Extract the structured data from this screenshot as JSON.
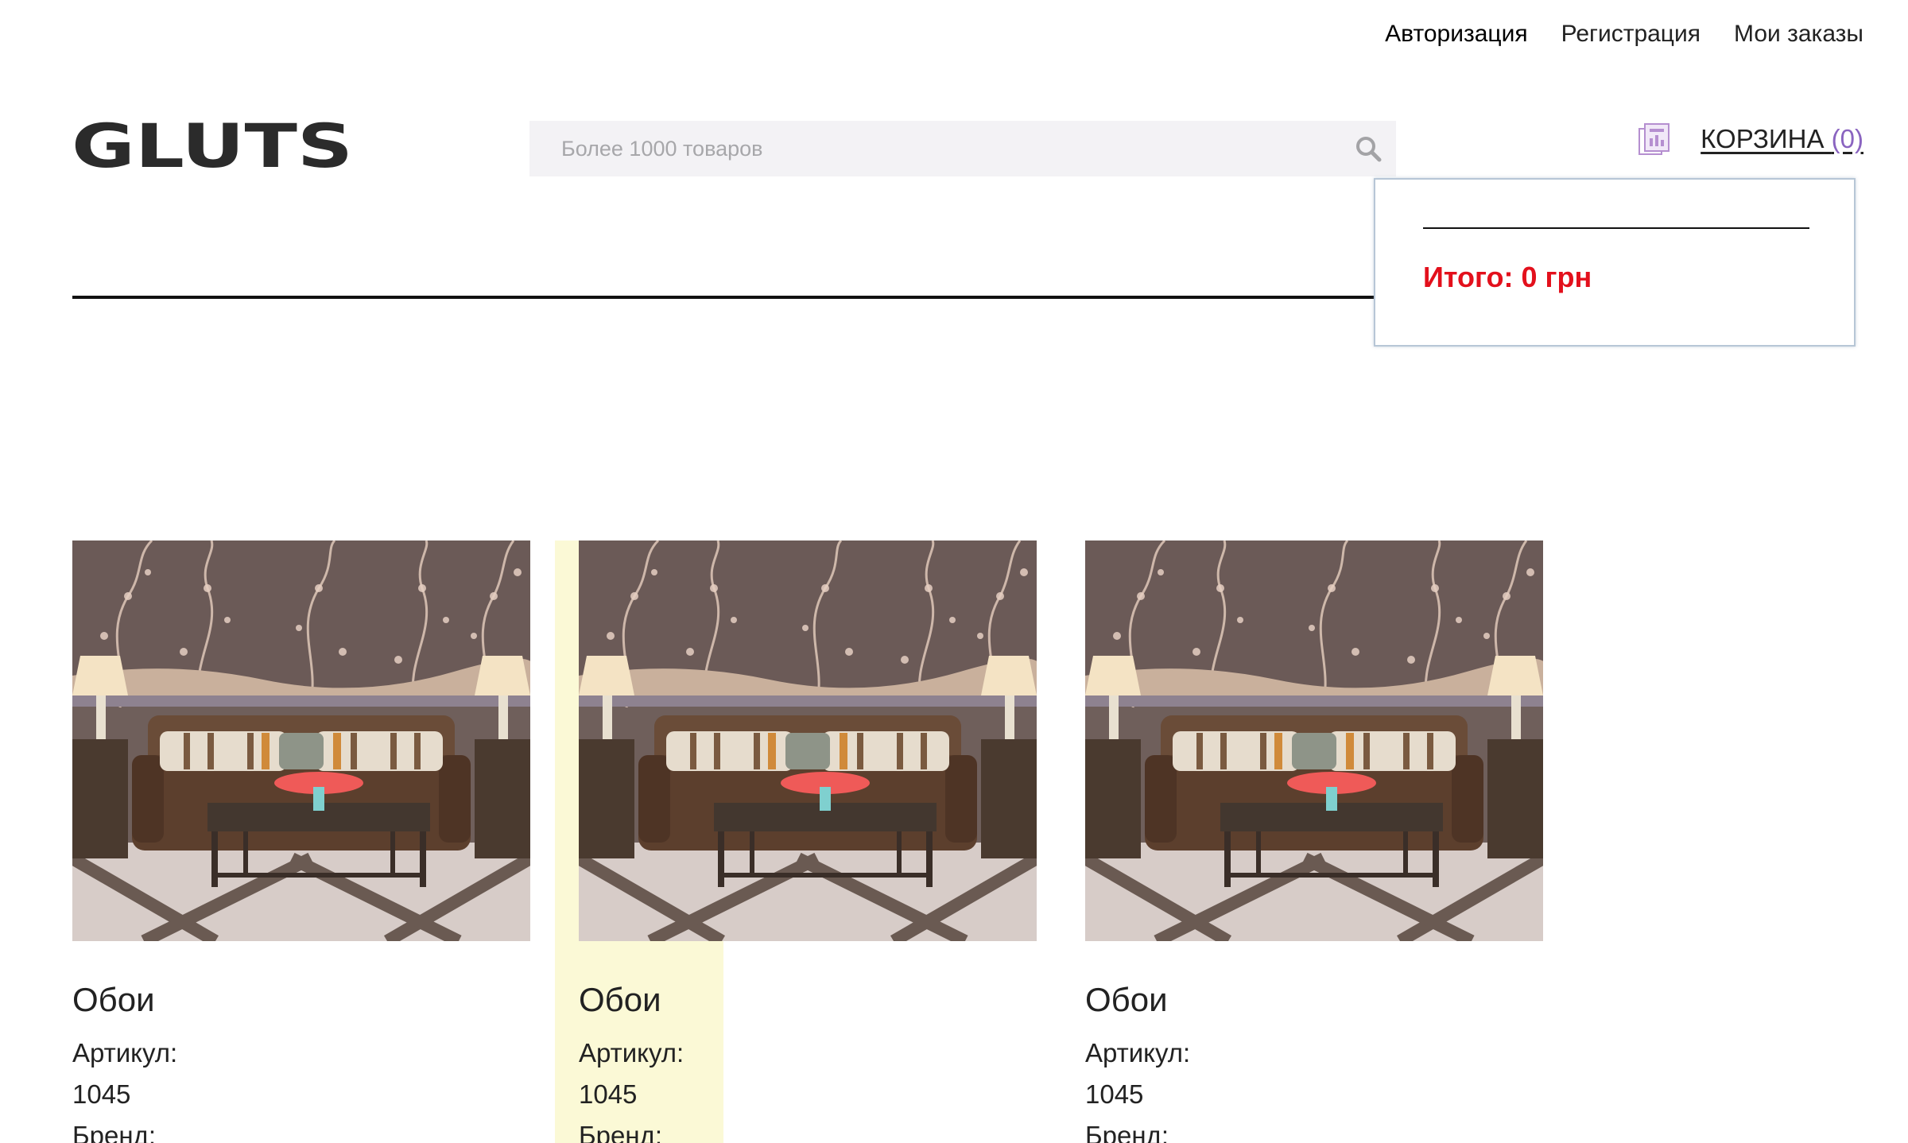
{
  "top_nav": {
    "login": "Авторизация",
    "register": "Регистрация",
    "orders": "Мои заказы"
  },
  "logo": {
    "text": "GLUTS"
  },
  "search": {
    "placeholder": "Более 1000 товаров",
    "icon": "search-icon"
  },
  "cart": {
    "icon": "cart-icon",
    "label": "КОРЗИНА",
    "count": "(0)",
    "popup": {
      "total": "Итого: 0 грн"
    }
  },
  "products": [
    {
      "name": "Обои",
      "article_label": "Артикул:",
      "article": "1045",
      "brand_label": "Бренд:"
    },
    {
      "name": "Обои",
      "article_label": "Артикул:",
      "article": "1045",
      "brand_label": "Бренд:"
    },
    {
      "name": "Обои",
      "article_label": "Артикул:",
      "article": "1045",
      "brand_label": "Бренд:"
    }
  ],
  "colors": {
    "accent_total": "#e3101c",
    "cart_count": "#8a64c0",
    "search_bg": "#f3f2f5",
    "highlight": "#fbf9d6"
  }
}
